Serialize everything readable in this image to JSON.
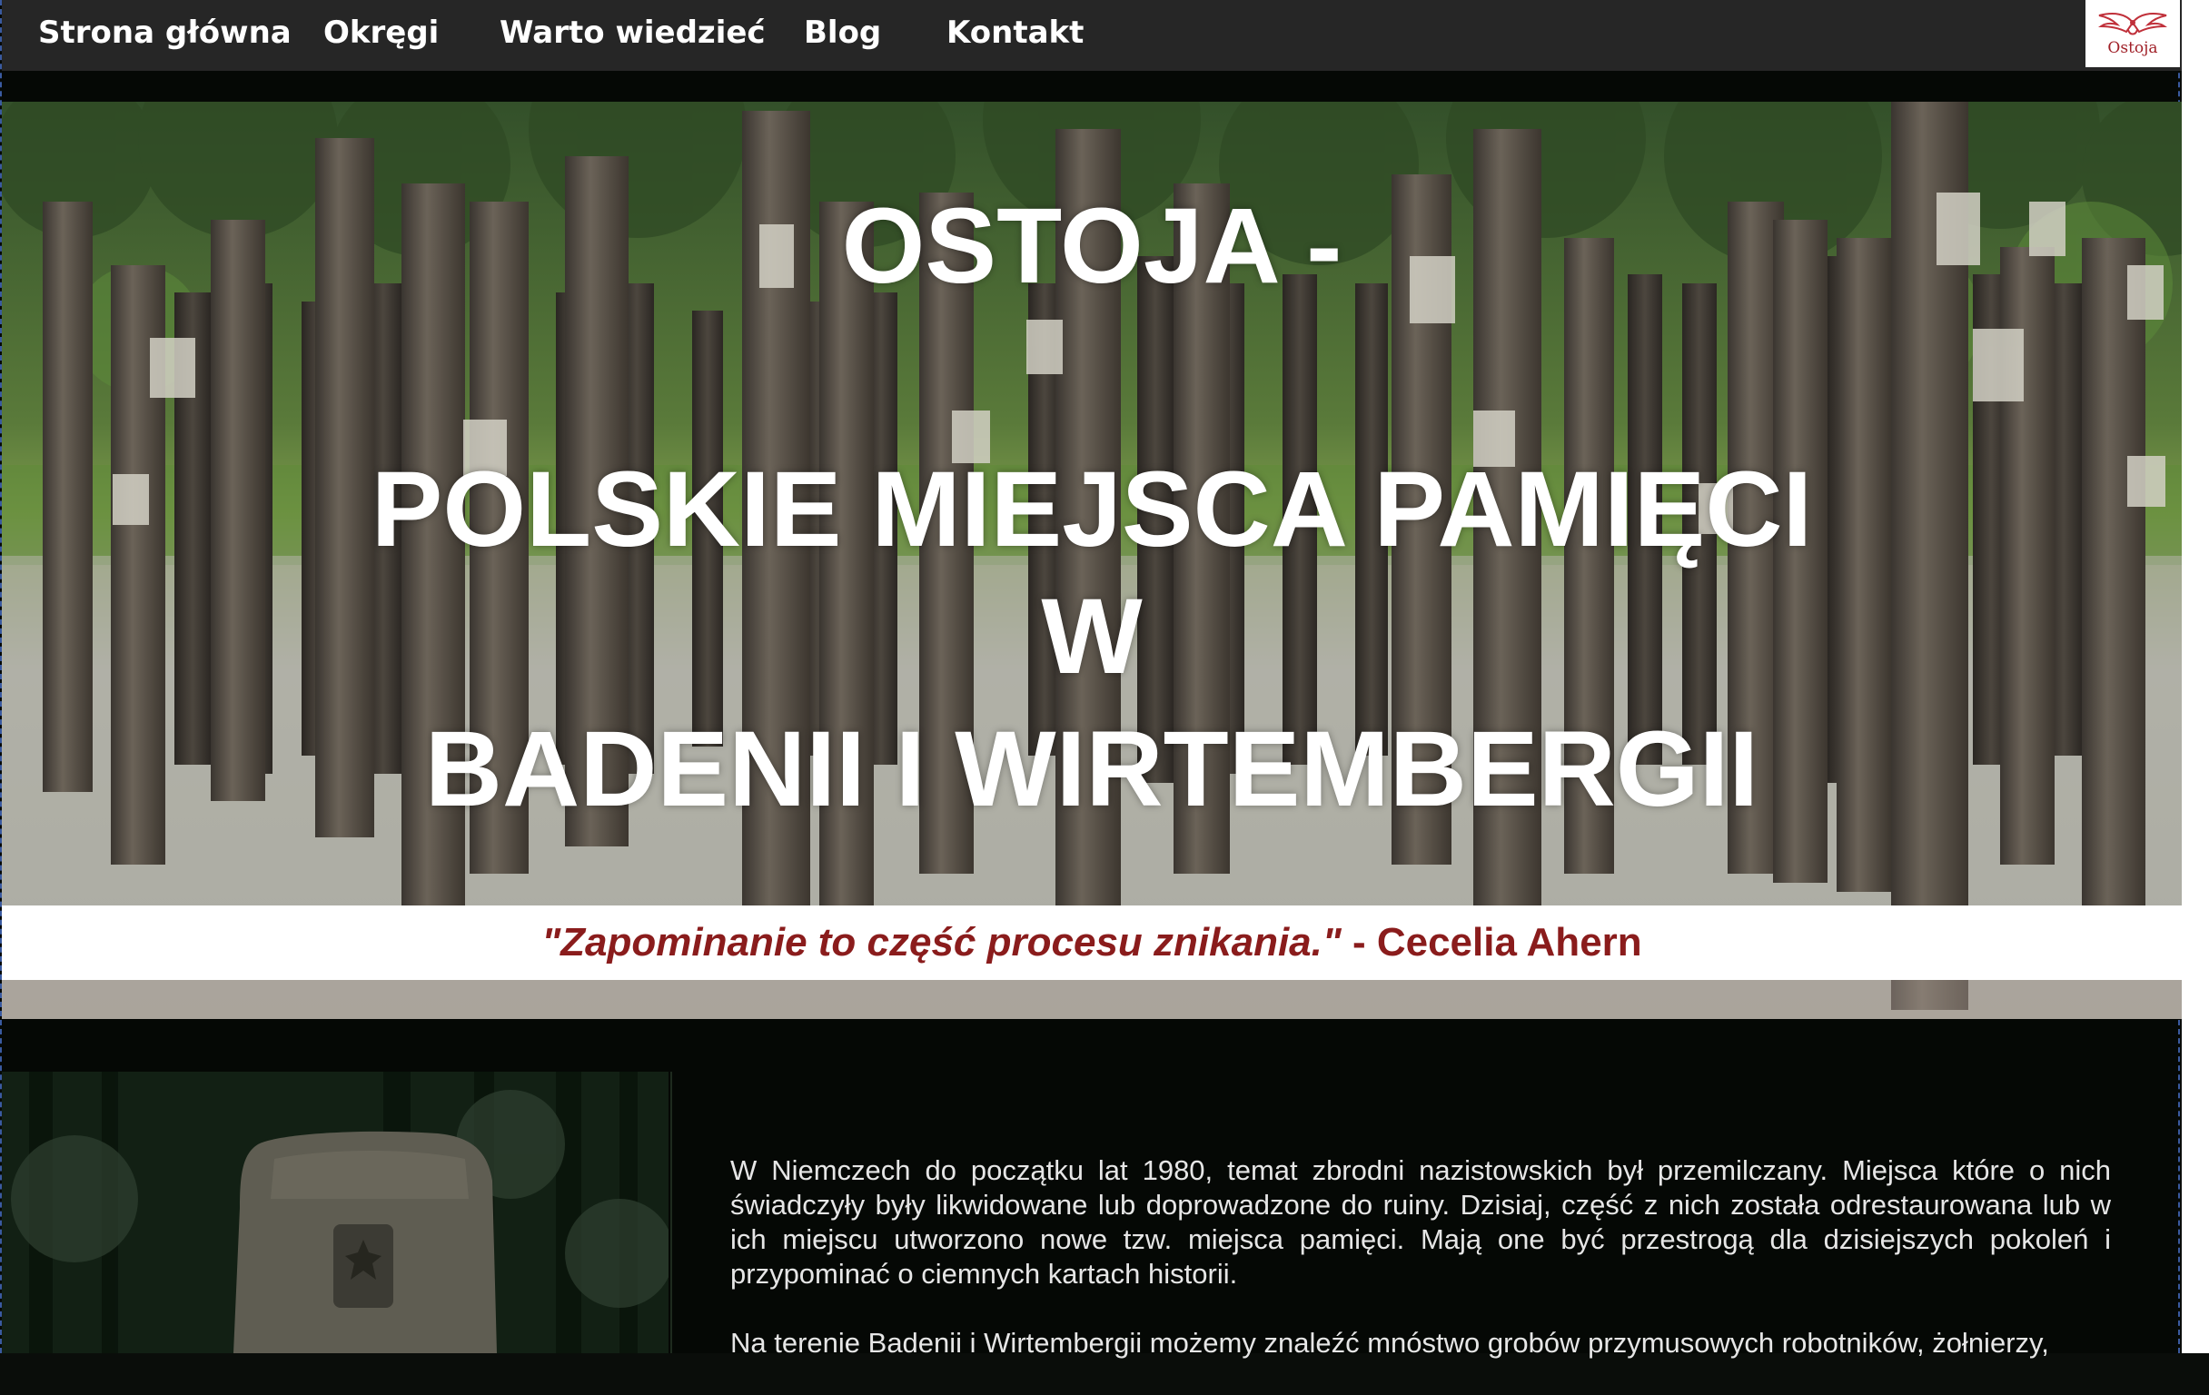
{
  "nav": {
    "items": [
      {
        "label": "Strona główna"
      },
      {
        "label": "Okręgi"
      },
      {
        "label": "Warto wiedzieć"
      },
      {
        "label": "Blog"
      },
      {
        "label": "Kontakt"
      }
    ],
    "logo_text": "Ostoja"
  },
  "hero": {
    "line1": "OSTOJA -",
    "line2": "POLSKIE MIEJSCA PAMIĘCI",
    "line3": "W",
    "line4": "BADENII I WIRTEMBERGII",
    "quote": "\"Zapominanie to część procesu znikania.\"",
    "quote_author": " - Cecelia Ahern"
  },
  "content": {
    "paragraph1": "W Niemczech do początku lat 1980, temat zbrodni nazistowskich był  przemilczany. Miejsca które o nich świadczyły były likwidowane lub doprowadzone do ruiny. Dzisiaj, część z nich została odrestaurowana lub w ich miejscu utworzono nowe tzw. miejsca pamięci. Mają one być przestrogą dla dzisiejszych pokoleń i  przypominać o ciemnych kartach historii.",
    "paragraph2": "Na terenie Badenii i Wirtembergii możemy znaleźć  mnóstwo grobów przymusowych robotników, żołnierzy,"
  },
  "colors": {
    "nav_bg": "#262626",
    "quote_color": "#8a1c1c",
    "page_bg": "#050805"
  }
}
